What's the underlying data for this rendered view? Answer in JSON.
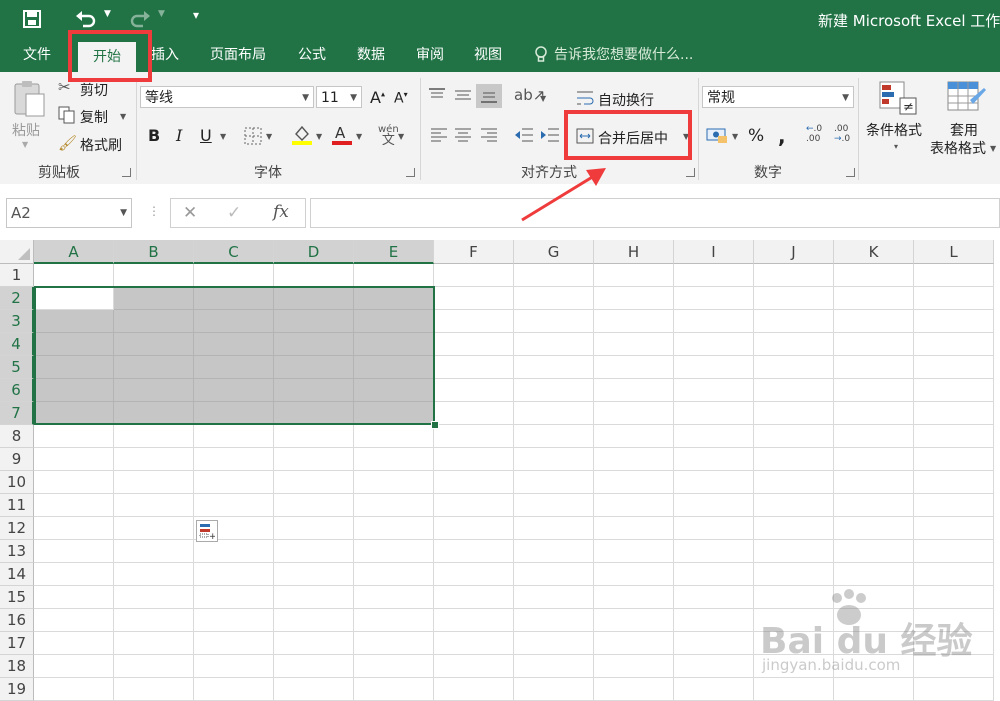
{
  "window": {
    "title": "新建 Microsoft Excel 工作"
  },
  "tabs": [
    {
      "label": "文件"
    },
    {
      "label": "开始"
    },
    {
      "label": "插入"
    },
    {
      "label": "页面布局"
    },
    {
      "label": "公式"
    },
    {
      "label": "数据"
    },
    {
      "label": "审阅"
    },
    {
      "label": "视图"
    }
  ],
  "tell_me": "告诉我您想要做什么...",
  "clipboard": {
    "paste": "粘贴",
    "cut": "剪切",
    "copy": "复制",
    "format_painter": "格式刷",
    "group": "剪贴板"
  },
  "font": {
    "name": "等线",
    "size": "11",
    "bold": "B",
    "italic": "I",
    "underline": "U",
    "group": "字体"
  },
  "alignment": {
    "wrap": "自动换行",
    "merge": "合并后居中",
    "group": "对齐方式"
  },
  "number": {
    "format": "常规",
    "percent": "%",
    "comma": ",",
    "group": "数字"
  },
  "styles": {
    "conditional": "条件格式",
    "table_1": "套用",
    "table_2": "表格格式"
  },
  "formula_bar": {
    "name_box": "A2",
    "fx": "fx",
    "value": ""
  },
  "columns": [
    "A",
    "B",
    "C",
    "D",
    "E",
    "F",
    "G",
    "H",
    "I",
    "J",
    "K",
    "L"
  ],
  "rows": [
    "1",
    "2",
    "3",
    "4",
    "5",
    "6",
    "7",
    "8",
    "9",
    "10",
    "11",
    "12",
    "13",
    "14",
    "15",
    "16",
    "17",
    "18",
    "19"
  ],
  "selection": {
    "range": "A2:E7",
    "active": "A2"
  },
  "watermark": {
    "brand": "Bai du 经验",
    "url": "jingyan.baidu.com"
  },
  "colors": {
    "accent": "#217346",
    "highlight": "#ef3b3b"
  }
}
